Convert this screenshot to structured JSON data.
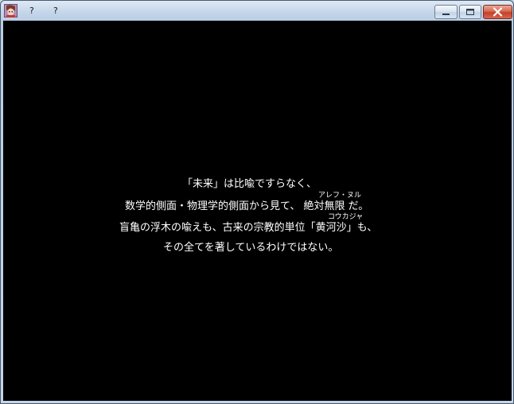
{
  "titlebar": {
    "icon": "character-portrait-icon",
    "menu": [
      "?",
      "?"
    ],
    "controls": {
      "minimize_icon": "minimize-icon",
      "maximize_icon": "maximize-icon",
      "close_icon": "close-icon"
    }
  },
  "scene": {
    "background_color": "#000000",
    "text_color": "#ffffff",
    "lines": [
      {
        "text": "「未来」は比喩ですらなく、"
      },
      {
        "before": "数学的側面・物理学的側面から見て、 ",
        "ruby_base": "絶対無限",
        "ruby_text": "アレフ・ヌル",
        "after": " だ。"
      },
      {
        "before": "盲亀の浮木の喩えも、古来の宗教的単位「",
        "ruby_base": "黄河沙",
        "ruby_text": "コウカジャ",
        "after": "」も、"
      },
      {
        "text": "その全てを著しているわけではない。"
      }
    ]
  }
}
